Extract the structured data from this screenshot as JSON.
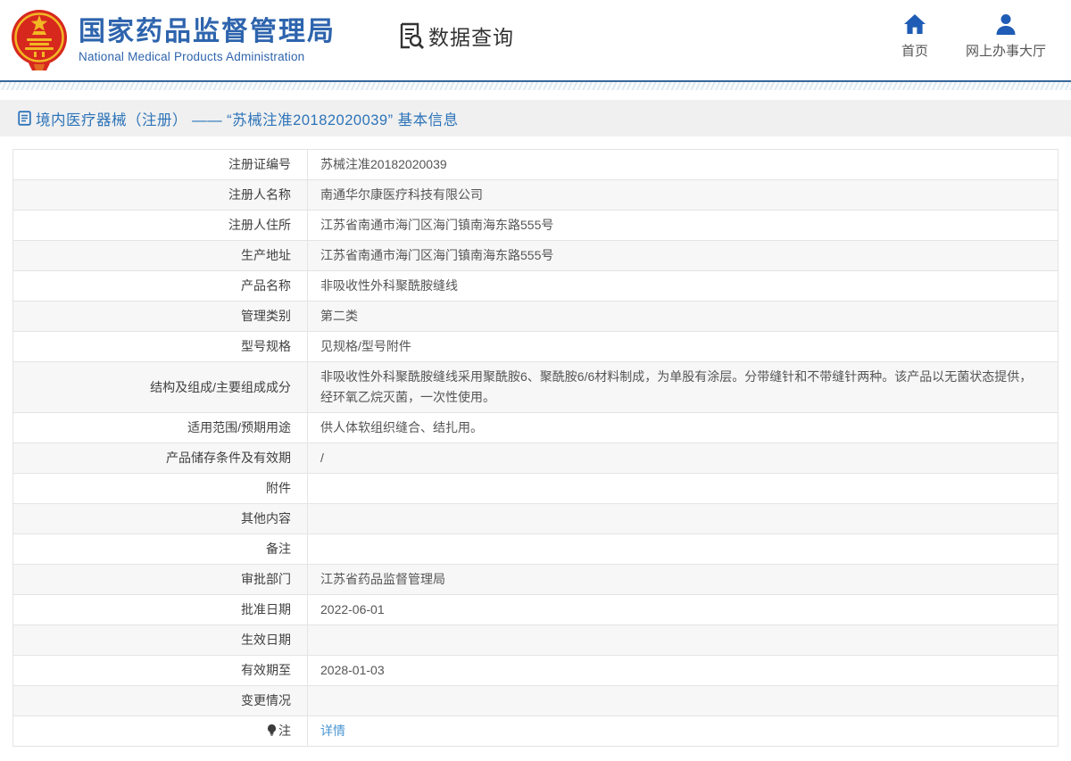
{
  "header": {
    "org": {
      "title": "国家药品监督管理局",
      "subtitle": "National Medical Products Administration",
      "emblem": "china-national-emblem"
    },
    "section": {
      "label": "数据查询",
      "icon": "document-search-icon"
    },
    "nav": [
      {
        "label": "首页",
        "icon": "home-icon"
      },
      {
        "label": "网上办事大厅",
        "icon": "person-icon"
      }
    ]
  },
  "page_title": {
    "icon": "document-icon",
    "text": "境内医疗器械（注册） —— “苏械注准20182020039” 基本信息"
  },
  "table": {
    "rows": [
      {
        "label": "注册证编号",
        "value": "苏械注准20182020039"
      },
      {
        "label": "注册人名称",
        "value": "南通华尔康医疗科技有限公司"
      },
      {
        "label": "注册人住所",
        "value": "江苏省南通市海门区海门镇南海东路555号"
      },
      {
        "label": "生产地址",
        "value": "江苏省南通市海门区海门镇南海东路555号"
      },
      {
        "label": "产品名称",
        "value": "非吸收性外科聚酰胺缝线"
      },
      {
        "label": "管理类别",
        "value": "第二类"
      },
      {
        "label": "型号规格",
        "value": "见规格/型号附件"
      },
      {
        "label": "结构及组成/主要组成成分",
        "value": "非吸收性外科聚酰胺缝线采用聚酰胺6、聚酰胺6/6材料制成，为单股有涂层。分带缝针和不带缝针两种。该产品以无菌状态提供，经环氧乙烷灭菌，一次性使用。"
      },
      {
        "label": "适用范围/预期用途",
        "value": "供人体软组织缝合、结扎用。"
      },
      {
        "label": "产品储存条件及有效期",
        "value": "/"
      },
      {
        "label": "附件",
        "value": ""
      },
      {
        "label": "其他内容",
        "value": ""
      },
      {
        "label": "备注",
        "value": ""
      },
      {
        "label": "审批部门",
        "value": "江苏省药品监督管理局"
      },
      {
        "label": "批准日期",
        "value": "2022-06-01"
      },
      {
        "label": "生效日期",
        "value": ""
      },
      {
        "label": "有效期至",
        "value": "2028-01-03"
      },
      {
        "label": "变更情况",
        "value": ""
      },
      {
        "label": "注",
        "label_icon": "bulb-icon",
        "value": "详情",
        "value_is_link": true
      }
    ]
  },
  "colors": {
    "brand_blue": "#2e64ad",
    "nav_icon_blue": "#1f5cb5",
    "title_blue": "#2d74b9",
    "link_blue": "#4a96d2",
    "titlebar_bg": "#f0f0f0",
    "zebra_gray": "#f7f7f7",
    "divider_blue": "#38689b"
  }
}
